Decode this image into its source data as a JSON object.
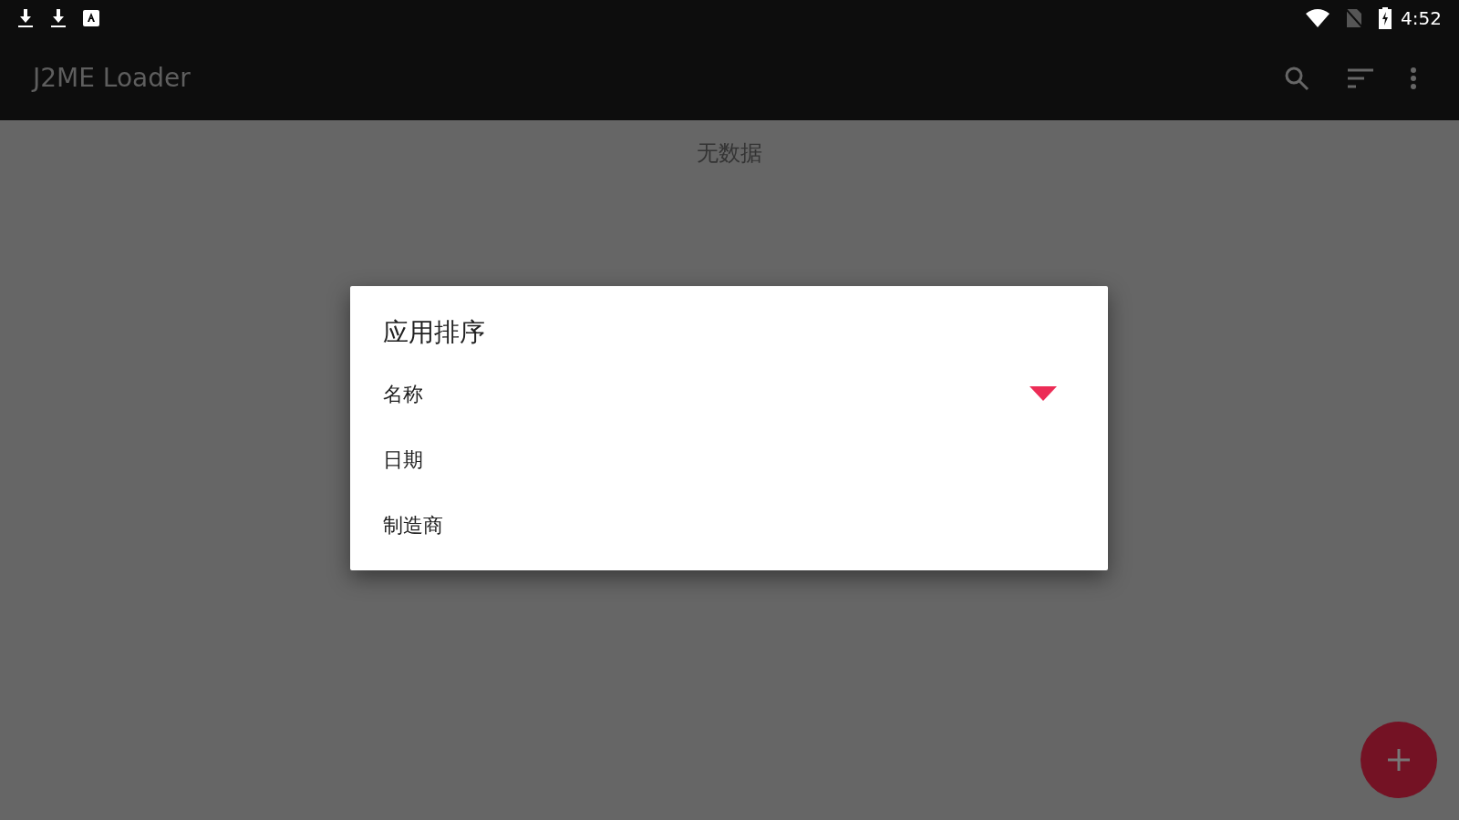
{
  "status_bar": {
    "time": "4:52"
  },
  "toolbar": {
    "title": "J2ME Loader"
  },
  "content": {
    "empty_text": "无数据"
  },
  "sort_dialog": {
    "title": "应用排序",
    "options": [
      {
        "label": "名称",
        "selected": true
      },
      {
        "label": "日期",
        "selected": false
      },
      {
        "label": "制造商",
        "selected": false
      }
    ]
  }
}
